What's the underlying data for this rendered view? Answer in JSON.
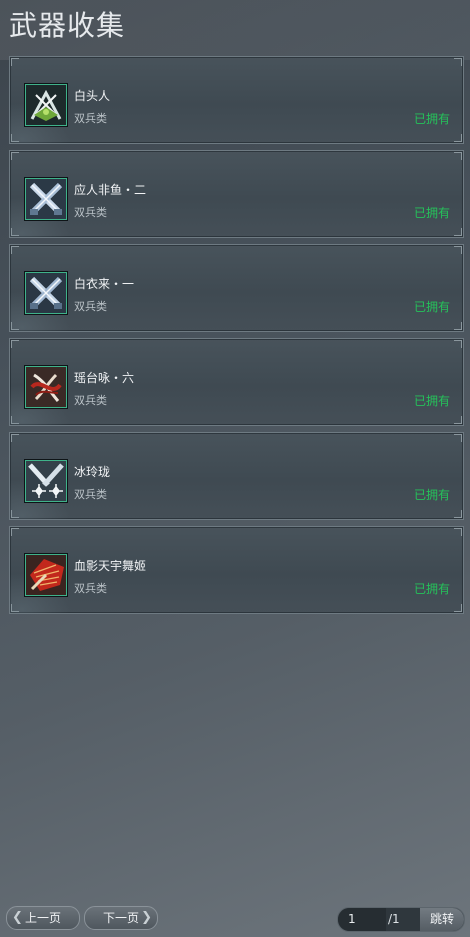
{
  "header": {
    "title": "武器收集"
  },
  "weapons": [
    {
      "name": "白头人",
      "type": "双兵类",
      "status": "已拥有",
      "icon": "crossed-blades-emblem-icon"
    },
    {
      "name": "应人非鱼・二",
      "type": "双兵类",
      "status": "已拥有",
      "icon": "crossed-twin-blades-icon"
    },
    {
      "name": "白衣来・一",
      "type": "双兵类",
      "status": "已拥有",
      "icon": "crossed-twin-blades-icon"
    },
    {
      "name": "瑶台咏・六",
      "type": "双兵类",
      "status": "已拥有",
      "icon": "red-ribbon-blades-icon"
    },
    {
      "name": "冰玲珑",
      "type": "双兵类",
      "status": "已拥有",
      "icon": "frost-star-blades-icon"
    },
    {
      "name": "血影天宇舞姬",
      "type": "双兵类",
      "status": "已拥有",
      "icon": "red-fan-blades-icon"
    }
  ],
  "pagination": {
    "prev_label": "上一页",
    "next_label": "下一页",
    "current_page": "1",
    "total_pages": "/1",
    "jump_label": "跳转"
  },
  "colors": {
    "owned": "#25c25a",
    "icon_border": "#3fb28a"
  }
}
